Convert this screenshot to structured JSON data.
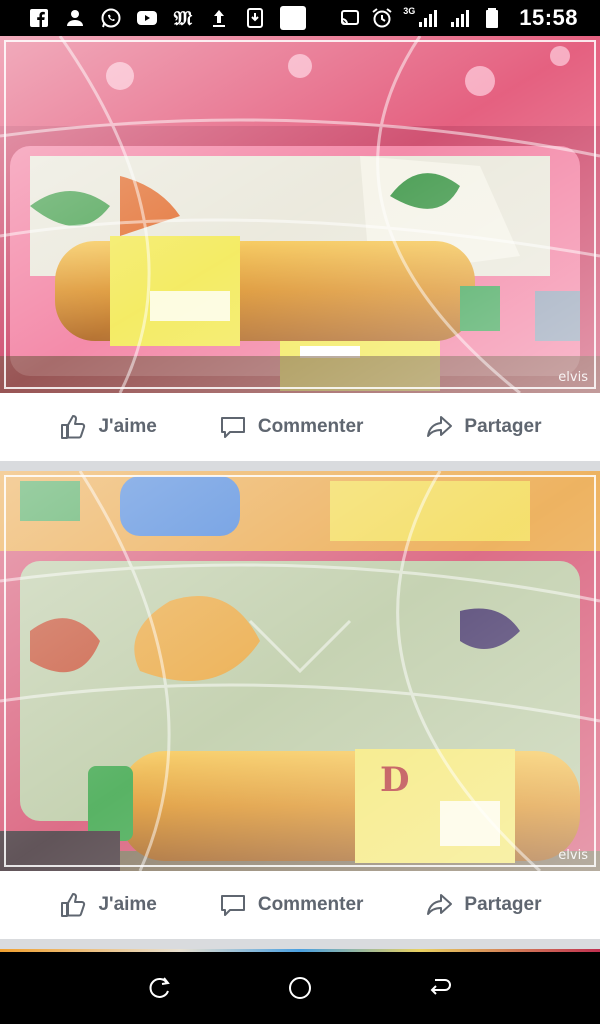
{
  "status_bar": {
    "time": "15:58",
    "network": "3G",
    "left_icons": [
      "facebook-icon",
      "person-add-icon",
      "whatsapp-icon",
      "youtube-icon",
      "news-m-icon",
      "upload-icon",
      "download-icon",
      "white-square-icon"
    ],
    "right_icons": [
      "cast-icon",
      "alarm-icon",
      "signal-icon",
      "signal-icon",
      "battery-icon"
    ]
  },
  "posts": [
    {
      "watermark": "elvis",
      "actions": {
        "like": "J'aime",
        "comment": "Commenter",
        "share": "Partager"
      }
    },
    {
      "watermark": "elvis",
      "actions": {
        "like": "J'aime",
        "comment": "Commenter",
        "share": "Partager"
      }
    }
  ],
  "nav_bar": {
    "buttons": [
      "recent-apps-icon",
      "home-icon",
      "back-icon"
    ]
  }
}
